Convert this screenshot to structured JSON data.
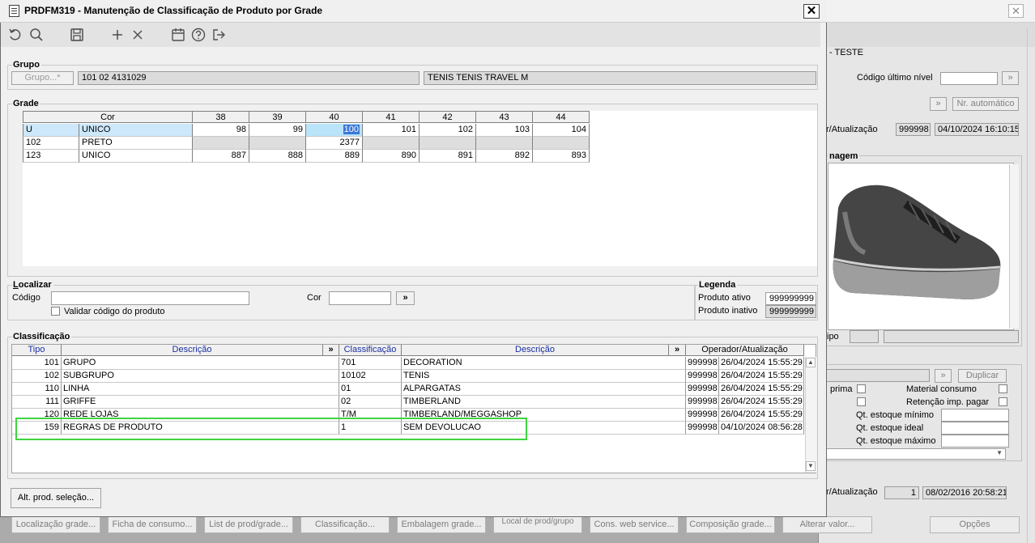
{
  "dialog": {
    "title": "PRDFM319 - Manutenção de Classificação de Produto por Grade"
  },
  "toolbar": {
    "icons": [
      "undo-icon",
      "search-icon",
      "save-icon",
      "add-icon",
      "delete-icon",
      "calendar-icon",
      "help-icon",
      "exit-icon"
    ]
  },
  "grupo": {
    "label": "Grupo",
    "button": "Grupo...*",
    "code": "101 02 4131029",
    "description": "TENIS TENIS TRAVEL M"
  },
  "grade": {
    "label": "Grade",
    "cor_header": "Cor",
    "sizes": [
      "38",
      "39",
      "40",
      "41",
      "42",
      "43",
      "44"
    ],
    "rows": [
      {
        "code": "U",
        "name": "UNICO",
        "values": [
          "98",
          "99",
          "100",
          "101",
          "102",
          "103",
          "104"
        ]
      },
      {
        "code": "102",
        "name": "PRETO",
        "values": [
          "",
          "",
          "2377",
          "",
          "",
          "",
          ""
        ]
      },
      {
        "code": "123",
        "name": "UNICO",
        "values": [
          "887",
          "888",
          "889",
          "890",
          "891",
          "892",
          "893"
        ]
      }
    ]
  },
  "localizar": {
    "label": "Localizar",
    "codigo_label": "Código",
    "codigo_value": "",
    "cor_label": "Cor",
    "cor_value": "",
    "go_button": "»",
    "validar_label": "Validar código do produto"
  },
  "legenda": {
    "label": "Legenda",
    "ativo_label": "Produto ativo",
    "ativo_value": "999999999",
    "inativo_label": "Produto inativo",
    "inativo_value": "999999999"
  },
  "classificacao": {
    "label": "Classificação",
    "headers": {
      "tipo": "Tipo",
      "descricao1": "Descrição",
      "expand1": "»",
      "classificacao": "Classificação",
      "descricao2": "Descrição",
      "expand2": "»",
      "operador": "Operador/Atualização"
    },
    "rows": [
      {
        "tipo": "101",
        "desc": "GRUPO",
        "cls": "701",
        "cdesc": "DECORATION",
        "op": "999998",
        "date": "26/04/2024 15:55:29"
      },
      {
        "tipo": "102",
        "desc": "SUBGRUPO",
        "cls": "10102",
        "cdesc": "TENIS",
        "op": "999998",
        "date": "26/04/2024 15:55:29"
      },
      {
        "tipo": "110",
        "desc": "LINHA",
        "cls": "01",
        "cdesc": "ALPARGATAS",
        "op": "999998",
        "date": "26/04/2024 15:55:29"
      },
      {
        "tipo": "111",
        "desc": "GRIFFE",
        "cls": "02",
        "cdesc": "TIMBERLAND",
        "op": "999998",
        "date": "26/04/2024 15:55:29"
      },
      {
        "tipo": "120",
        "desc": "REDE LOJAS",
        "cls": "T/M",
        "cdesc": "TIMBERLAND/MEGGASHOP",
        "op": "999998",
        "date": "26/04/2024 15:55:29"
      },
      {
        "tipo": "159",
        "desc": "REGRAS DE PRODUTO",
        "cls": "1",
        "cdesc": "SEM DEVOLUCAO",
        "op": "999998",
        "date": "04/10/2024 08:56:28"
      }
    ]
  },
  "alt_button": "Alt. prod. seleção...",
  "background": {
    "teste_text": "- TESTE",
    "codigo_ultimo_nivel": "Código último nível",
    "nr_automatico": "Nr. automático",
    "atualizacao1_label": "r/Atualização",
    "atualizacao1_op": "999998",
    "atualizacao1_date": "04/10/2024 16:10:15",
    "imagem_label": "nagem",
    "tipo_label": "ipo",
    "duplicar": "Duplicar",
    "prima_label": "prima",
    "material_consumo": "Material consumo",
    "retencao": "Retenção imp. pagar",
    "qt_minimo": "Qt. estoque mínimo",
    "qt_ideal": "Qt. estoque ideal",
    "qt_maximo": "Qt. estoque máximo",
    "atualizacao2_label": "r/Atualização",
    "atualizacao2_op": "1",
    "atualizacao2_date": "08/02/2016 20:58:21",
    "opcoes": "Opções"
  },
  "bottom_bar": [
    "Localização grade...",
    "Ficha de consumo...",
    "List de prod/grade...",
    "Classificação...",
    "Embalagem grade...",
    "Local de prod/grupo",
    "Cons. web service...",
    "Composição grade...",
    "Alterar valor..."
  ]
}
